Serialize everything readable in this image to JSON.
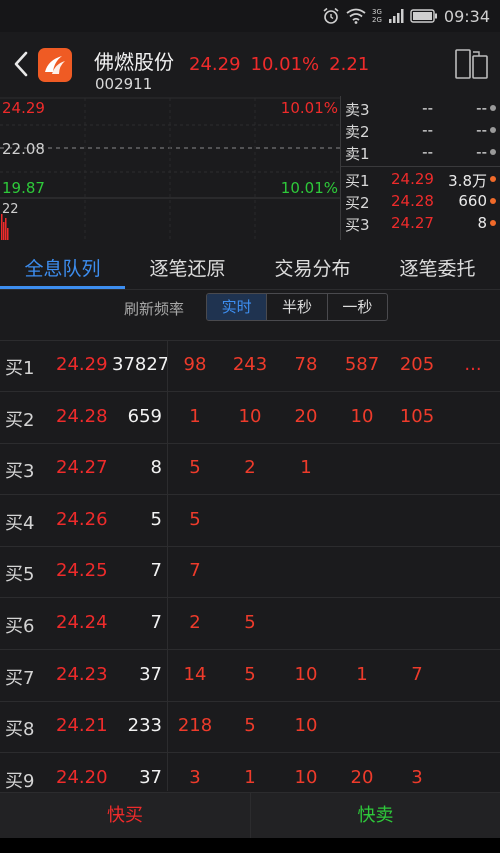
{
  "status": {
    "time": "09:34",
    "net_top": "3G",
    "net_bottom": "2G"
  },
  "header": {
    "name": "佛燃股份",
    "code": "002911",
    "price": "24.29",
    "change_pct": "10.01%",
    "change": "2.21"
  },
  "chart": {
    "top_price": "24.29",
    "top_pct": "10.01%",
    "mid_price": "22.08",
    "bottom_price": "19.87",
    "bottom_pct": "10.01%",
    "volume_label": "22"
  },
  "orderbook": {
    "sell": [
      {
        "label": "卖3",
        "price": "--",
        "volume": "--"
      },
      {
        "label": "卖2",
        "price": "--",
        "volume": "--"
      },
      {
        "label": "卖1",
        "price": "--",
        "volume": "--"
      }
    ],
    "buy": [
      {
        "label": "买1",
        "price": "24.29",
        "volume": "3.8万"
      },
      {
        "label": "买2",
        "price": "24.28",
        "volume": "660"
      },
      {
        "label": "买3",
        "price": "24.27",
        "volume": "8"
      }
    ]
  },
  "tabs": [
    "全息队列",
    "逐笔还原",
    "交易分布",
    "逐笔委托"
  ],
  "refresh": {
    "label": "刷新频率",
    "options": [
      "实时",
      "半秒",
      "一秒"
    ]
  },
  "queue": [
    {
      "label": "买1",
      "price": "24.29",
      "volume": "37827",
      "orders": [
        "98",
        "243",
        "78",
        "587",
        "205",
        "..."
      ]
    },
    {
      "label": "买2",
      "price": "24.28",
      "volume": "659",
      "orders": [
        "1",
        "10",
        "20",
        "10",
        "105"
      ]
    },
    {
      "label": "买3",
      "price": "24.27",
      "volume": "8",
      "orders": [
        "5",
        "2",
        "1"
      ]
    },
    {
      "label": "买4",
      "price": "24.26",
      "volume": "5",
      "orders": [
        "5"
      ]
    },
    {
      "label": "买5",
      "price": "24.25",
      "volume": "7",
      "orders": [
        "7"
      ]
    },
    {
      "label": "买6",
      "price": "24.24",
      "volume": "7",
      "orders": [
        "2",
        "5"
      ]
    },
    {
      "label": "买7",
      "price": "24.23",
      "volume": "37",
      "orders": [
        "14",
        "5",
        "10",
        "1",
        "7"
      ]
    },
    {
      "label": "买8",
      "price": "24.21",
      "volume": "233",
      "orders": [
        "218",
        "5",
        "10"
      ]
    },
    {
      "label": "买9",
      "price": "24.20",
      "volume": "37",
      "orders": [
        "3",
        "1",
        "10",
        "20",
        "3"
      ]
    }
  ],
  "actions": {
    "buy": "快买",
    "sell": "快卖"
  },
  "colors": {
    "up": "#ee2b2b",
    "down": "#2ec93a",
    "accent": "#3d8ef0",
    "logo": "#ef5b24"
  }
}
